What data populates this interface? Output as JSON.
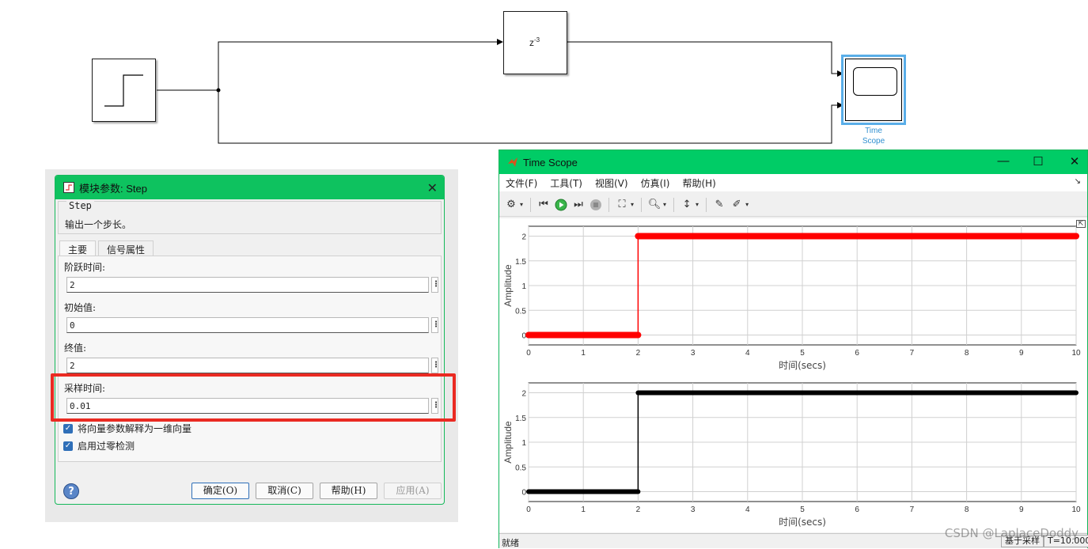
{
  "diagram": {
    "delay_block": {
      "base": "z",
      "exponent": "-3"
    },
    "scope_block": {
      "label_line1": "Time",
      "label_line2": "Scope"
    },
    "icons": {
      "step_block": "step-waveform-icon",
      "scope_block": "scope-screen-icon"
    }
  },
  "step_dialog": {
    "title": "模块参数: Step",
    "group_name": "Step",
    "description": "输出一个步长。",
    "tabs": [
      {
        "label": "主要"
      },
      {
        "label": "信号属性"
      }
    ],
    "fields": {
      "step_time": {
        "label": "阶跃时间:",
        "value": "2"
      },
      "initial_value": {
        "label": "初始值:",
        "value": "0"
      },
      "final_value": {
        "label": "终值:",
        "value": "2"
      },
      "sample_time": {
        "label": "采样时间:",
        "value": "0.01"
      }
    },
    "checkboxes": [
      {
        "label": "将向量参数解释为一维向量",
        "checked": true
      },
      {
        "label": "启用过零检测",
        "checked": true
      }
    ],
    "buttons": {
      "help_icon": "?",
      "ok": "确定(O)",
      "cancel": "取消(C)",
      "help": "帮助(H)",
      "apply": "应用(A)"
    },
    "highlight_color": "#ea2a22",
    "accent_color": "#0ec25f"
  },
  "time_scope": {
    "title": "Time Scope",
    "window_controls": {
      "minimize": "—",
      "maximize": "☐",
      "close": "✕"
    },
    "menu": [
      "文件(F)",
      "工具(T)",
      "视图(V)",
      "仿真(I)",
      "帮助(H)"
    ],
    "menu_right_glyph": "↘",
    "toolbar_icons": [
      "settings-icon",
      "step-back-icon",
      "run-icon",
      "step-forward-icon",
      "stop-icon",
      "signal-selector-icon",
      "zoom-icon",
      "scale-axes-icon",
      "highlight-icon",
      "measurements-icon"
    ],
    "status": {
      "left": "就绪",
      "mode": "基于采样",
      "time": "T=10.000"
    },
    "undock_glyph": "⇱"
  },
  "chart_data": [
    {
      "type": "line",
      "title": "",
      "xlabel": "时间(secs)",
      "ylabel": "Amplitude",
      "xlim": [
        0,
        10
      ],
      "ylim": [
        -0.2,
        2.2
      ],
      "x_ticks": [
        "0",
        "1",
        "2",
        "3",
        "4",
        "5",
        "6",
        "7",
        "8",
        "9",
        "10"
      ],
      "y_ticks": [
        "0",
        "0.5",
        "1",
        "1.5",
        "2"
      ],
      "grid": true,
      "color": "#ff0000",
      "series": [
        {
          "x": [
            0,
            2,
            2,
            10
          ],
          "y": [
            0,
            0,
            2,
            2
          ]
        }
      ]
    },
    {
      "type": "line",
      "title": "",
      "xlabel": "时间(secs)",
      "ylabel": "Amplitude",
      "xlim": [
        0,
        10
      ],
      "ylim": [
        -0.2,
        2.2
      ],
      "x_ticks": [
        "0",
        "1",
        "2",
        "3",
        "4",
        "5",
        "6",
        "7",
        "8",
        "9",
        "10"
      ],
      "y_ticks": [
        "0",
        "0.5",
        "1",
        "1.5",
        "2"
      ],
      "grid": true,
      "color": "#000000",
      "series": [
        {
          "x": [
            0,
            2,
            2,
            10
          ],
          "y": [
            0,
            0,
            2,
            2
          ]
        }
      ]
    }
  ],
  "watermark": "CSDN @LaplaceDoddy"
}
